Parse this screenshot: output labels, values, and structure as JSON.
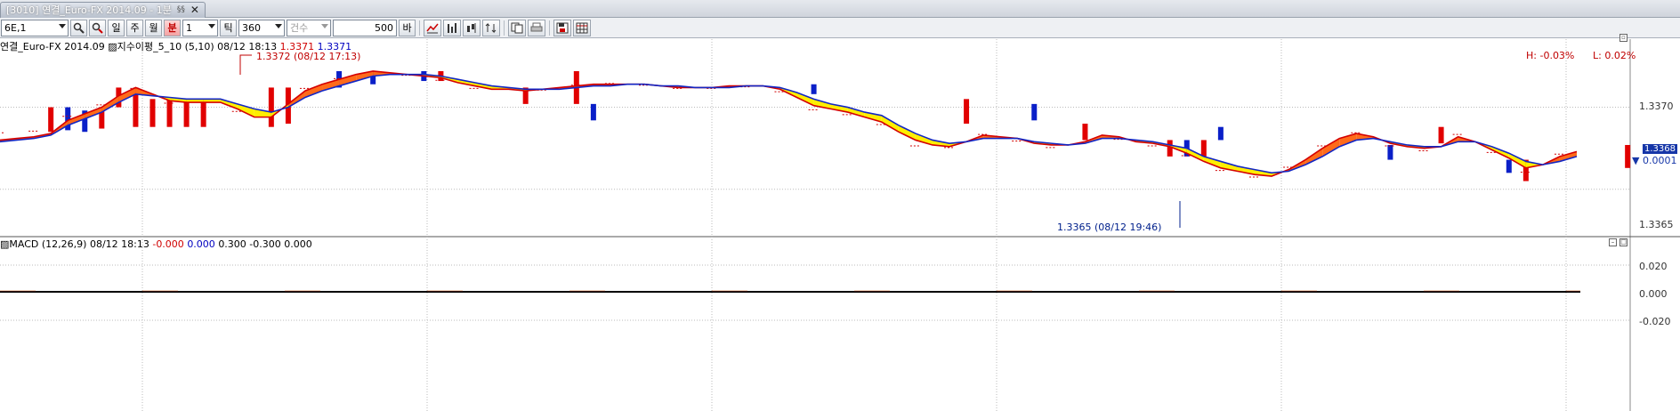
{
  "window": {
    "tab_title": "[3010] 연결_Euro-FX 2014.09 - 1분",
    "badge": "§§",
    "close_glyph": "✕"
  },
  "toolbar": {
    "symbol": "6E,1",
    "day_label": "일",
    "week_label": "주",
    "month_label": "월",
    "minute_label": "분",
    "minute_value": "1",
    "tick_label": "틱",
    "tick_value": "360",
    "count_label": "건수",
    "count_value": "500",
    "bar_label": "바",
    "icons": [
      "search-icon",
      "search-red-icon",
      "line-chart-icon",
      "bar-chart-icon",
      "candle-chart-icon",
      "updown-icon",
      "copy-icon",
      "print-icon",
      "save-icon",
      "table-icon"
    ]
  },
  "price_pane": {
    "legend_symbol": "연결_Euro-FX 2014.09",
    "legend_indicator": "지수이평_5_10",
    "legend_params": "(5,10)",
    "legend_time": "08/12 18:13",
    "legend_v1": "1.3371",
    "legend_v2": "1.3371",
    "high_text": "H: -0.03%",
    "low_text": "L: 0.02%",
    "current_price": "1.3368",
    "current_change": "▼ 0.0001",
    "max_label": "1.3372 (08/12 17:13)",
    "min_label": "1.3365 (08/12 19:46)",
    "y_ticks": [
      "1.3370",
      "1.3365"
    ]
  },
  "macd_pane": {
    "legend": "MACD  (12,26,9) 08/12 18:13",
    "v_macd": "-0.000",
    "v_signal": "0.000",
    "v_rest": "0.300 -0.300 0.000",
    "y_ticks": [
      "0.020",
      "0.000",
      "-0.020"
    ]
  },
  "chart_data": {
    "type": "line",
    "price_series": [
      1.33685,
      1.33685,
      1.33686,
      1.33688,
      1.33695,
      1.33697,
      1.33702,
      1.33708,
      1.33712,
      1.33705,
      1.33703,
      1.33704,
      1.33704,
      1.33703,
      1.33698,
      1.33692,
      1.33696,
      1.33705,
      1.33712,
      1.33716,
      1.33718,
      1.33721,
      1.33722,
      1.3372,
      1.3372,
      1.33719,
      1.33717,
      1.33714,
      1.33712,
      1.3371,
      1.33712,
      1.33709,
      1.33711,
      1.33713,
      1.33714,
      1.33714,
      1.33715,
      1.33715,
      1.33714,
      1.33713,
      1.33712,
      1.33713,
      1.33712,
      1.33714,
      1.33713,
      1.33714,
      1.3371,
      1.33703,
      1.33699,
      1.33697,
      1.33696,
      1.33693,
      1.3369,
      1.33682,
      1.33677,
      1.33675,
      1.33676,
      1.3368,
      1.33684,
      1.33682,
      1.3368,
      1.33677,
      1.33676,
      1.33678,
      1.33679,
      1.33684,
      1.33681,
      1.33678,
      1.33677,
      1.33675,
      1.33671,
      1.33665,
      1.33662,
      1.3366,
      1.33658,
      1.33658,
      1.33664,
      1.3367,
      1.33677,
      1.33683,
      1.33685,
      1.33681,
      1.33677,
      1.33675,
      1.33674,
      1.33677,
      1.33684,
      1.33678,
      1.33673,
      1.33668,
      1.33661,
      1.33667,
      1.33672,
      1.33675
    ],
    "ma_fast": [
      1.3368,
      1.33681,
      1.33682,
      1.33684,
      1.33692,
      1.33696,
      1.337,
      1.33707,
      1.33712,
      1.33708,
      1.33704,
      1.33703,
      1.33703,
      1.33703,
      1.33699,
      1.33694,
      1.33694,
      1.33702,
      1.3371,
      1.33714,
      1.33717,
      1.3372,
      1.33722,
      1.33721,
      1.3372,
      1.33719,
      1.33718,
      1.33715,
      1.33713,
      1.33711,
      1.33711,
      1.3371,
      1.33711,
      1.33712,
      1.33713,
      1.33714,
      1.33714,
      1.33714,
      1.33714,
      1.33713,
      1.33712,
      1.33712,
      1.33712,
      1.33713,
      1.33713,
      1.33713,
      1.33711,
      1.33706,
      1.33701,
      1.33699,
      1.33697,
      1.33694,
      1.33691,
      1.33685,
      1.3368,
      1.33677,
      1.33676,
      1.33679,
      1.33683,
      1.33682,
      1.33681,
      1.33678,
      1.33677,
      1.33677,
      1.33679,
      1.33683,
      1.33682,
      1.33679,
      1.33678,
      1.33676,
      1.33672,
      1.33667,
      1.33663,
      1.33661,
      1.33659,
      1.33658,
      1.33662,
      1.33668,
      1.33675,
      1.33681,
      1.33684,
      1.33682,
      1.33678,
      1.33676,
      1.33675,
      1.33676,
      1.33682,
      1.33679,
      1.33674,
      1.33669,
      1.33663,
      1.33665,
      1.3367,
      1.33673
    ],
    "ma_slow": [
      1.33679,
      1.3368,
      1.33681,
      1.33683,
      1.33689,
      1.33693,
      1.33697,
      1.33703,
      1.33708,
      1.33707,
      1.33706,
      1.33705,
      1.33705,
      1.33705,
      1.33702,
      1.33699,
      1.33697,
      1.337,
      1.33706,
      1.3371,
      1.33713,
      1.33716,
      1.33719,
      1.3372,
      1.3372,
      1.3372,
      1.33719,
      1.33717,
      1.33715,
      1.33713,
      1.33712,
      1.33711,
      1.33711,
      1.33711,
      1.33712,
      1.33713,
      1.33713,
      1.33714,
      1.33714,
      1.33713,
      1.33713,
      1.33712,
      1.33712,
      1.33712,
      1.33713,
      1.33713,
      1.33712,
      1.33709,
      1.33705,
      1.33702,
      1.337,
      1.33697,
      1.33695,
      1.33689,
      1.33684,
      1.3368,
      1.33678,
      1.33679,
      1.33681,
      1.33681,
      1.33681,
      1.33679,
      1.33678,
      1.33677,
      1.33678,
      1.33681,
      1.33681,
      1.3368,
      1.33679,
      1.33677,
      1.33675,
      1.3367,
      1.33667,
      1.33664,
      1.33662,
      1.3366,
      1.33661,
      1.33665,
      1.3367,
      1.33676,
      1.3368,
      1.33681,
      1.33679,
      1.33677,
      1.33676,
      1.33676,
      1.33679,
      1.33679,
      1.33676,
      1.33672,
      1.33667,
      1.33665,
      1.33667,
      1.3367
    ],
    "bars": [
      {
        "i": 3,
        "c": "red",
        "top": 1.337,
        "bot": 1.33685
      },
      {
        "i": 4,
        "c": "blue",
        "top": 1.337,
        "bot": 1.33686
      },
      {
        "i": 5,
        "c": "blue",
        "top": 1.33698,
        "bot": 1.33685
      },
      {
        "i": 6,
        "c": "red",
        "top": 1.337,
        "bot": 1.33687
      },
      {
        "i": 7,
        "c": "red",
        "top": 1.33712,
        "bot": 1.337
      },
      {
        "i": 8,
        "c": "red",
        "top": 1.33712,
        "bot": 1.33688
      },
      {
        "i": 9,
        "c": "red",
        "top": 1.33705,
        "bot": 1.33688
      },
      {
        "i": 10,
        "c": "red",
        "top": 1.33705,
        "bot": 1.33688
      },
      {
        "i": 11,
        "c": "red",
        "top": 1.33705,
        "bot": 1.33688
      },
      {
        "i": 12,
        "c": "red",
        "top": 1.33705,
        "bot": 1.33688
      },
      {
        "i": 16,
        "c": "red",
        "top": 1.33712,
        "bot": 1.33688
      },
      {
        "i": 17,
        "c": "red",
        "top": 1.33712,
        "bot": 1.3369
      },
      {
        "i": 20,
        "c": "blue",
        "top": 1.33722,
        "bot": 1.33712
      },
      {
        "i": 22,
        "c": "blue",
        "top": 1.33722,
        "bot": 1.33714
      },
      {
        "i": 25,
        "c": "blue",
        "top": 1.33722,
        "bot": 1.33716
      },
      {
        "i": 26,
        "c": "red",
        "top": 1.33722,
        "bot": 1.33716
      },
      {
        "i": 31,
        "c": "red",
        "top": 1.33712,
        "bot": 1.33702
      },
      {
        "i": 34,
        "c": "red",
        "top": 1.33722,
        "bot": 1.33702
      },
      {
        "i": 35,
        "c": "blue",
        "top": 1.33702,
        "bot": 1.33692
      },
      {
        "i": 48,
        "c": "blue",
        "top": 1.33714,
        "bot": 1.33708
      },
      {
        "i": 57,
        "c": "red",
        "top": 1.33705,
        "bot": 1.3369
      },
      {
        "i": 61,
        "c": "blue",
        "top": 1.33702,
        "bot": 1.33692
      },
      {
        "i": 64,
        "c": "red",
        "top": 1.3369,
        "bot": 1.3368
      },
      {
        "i": 69,
        "c": "red",
        "top": 1.3368,
        "bot": 1.3367
      },
      {
        "i": 70,
        "c": "blue",
        "top": 1.3368,
        "bot": 1.3367
      },
      {
        "i": 71,
        "c": "red",
        "top": 1.3368,
        "bot": 1.3367
      },
      {
        "i": 72,
        "c": "blue",
        "top": 1.33688,
        "bot": 1.3368
      },
      {
        "i": 82,
        "c": "blue",
        "top": 1.33677,
        "bot": 1.33668
      },
      {
        "i": 85,
        "c": "red",
        "top": 1.33688,
        "bot": 1.33678
      },
      {
        "i": 89,
        "c": "blue",
        "top": 1.33668,
        "bot": 1.3366
      },
      {
        "i": 90,
        "c": "red",
        "top": 1.33668,
        "bot": 1.33655
      },
      {
        "i": 96,
        "c": "red",
        "top": 1.33677,
        "bot": 1.33663
      },
      {
        "i": 103,
        "c": "red",
        "top": 1.33677,
        "bot": 1.33667
      },
      {
        "i": 106,
        "c": "red",
        "top": 1.33677,
        "bot": 1.33667
      },
      {
        "i": 110,
        "c": "blue",
        "top": 1.33698,
        "bot": 1.33688
      },
      {
        "i": 112,
        "c": "blue",
        "top": 1.33682,
        "bot": 1.33668
      },
      {
        "i": 118,
        "c": "red",
        "top": 1.33677,
        "bot": 1.33668
      }
    ],
    "y_range": [
      1.33645,
      1.33735
    ],
    "macd_range": [
      -0.03,
      0.03
    ],
    "macd_zero": 0.0
  }
}
